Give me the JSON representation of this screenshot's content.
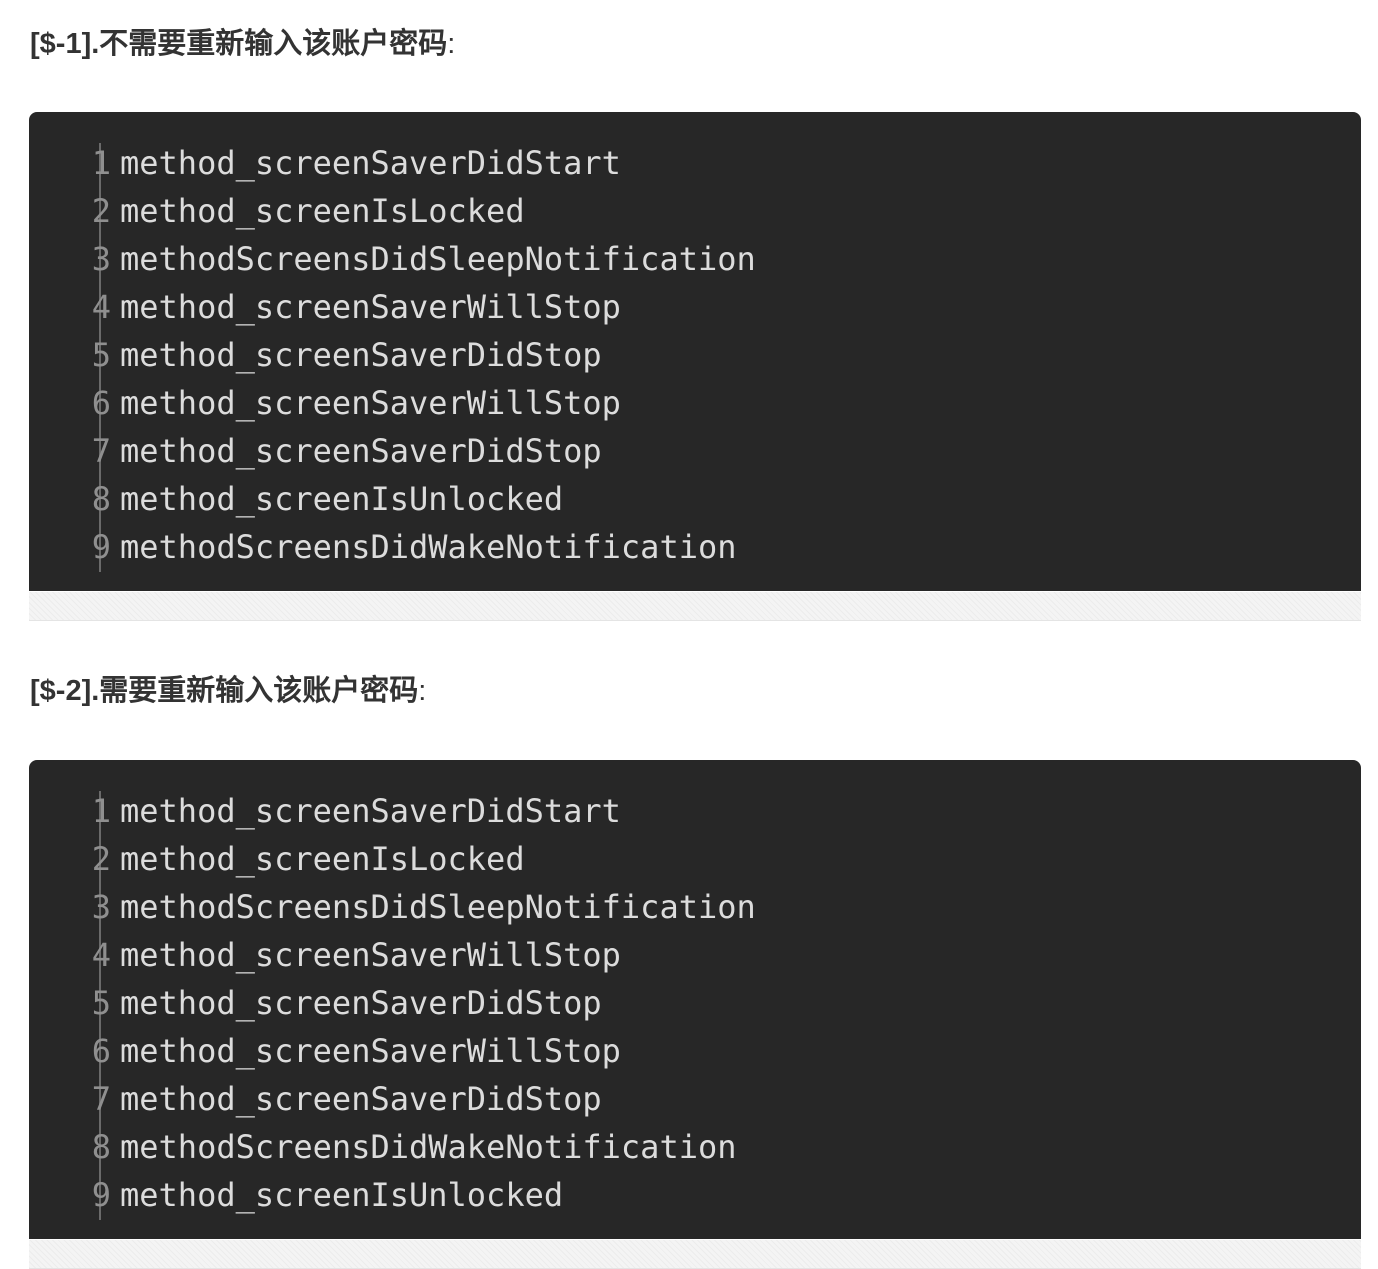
{
  "sections": [
    {
      "heading": "[$-1].不需要重新输入该账户密码",
      "heading_suffix": ":",
      "lines": [
        {
          "num": "1",
          "code": "method_screenSaverDidStart"
        },
        {
          "num": "2",
          "code": "method_screenIsLocked"
        },
        {
          "num": "3",
          "code": "methodScreensDidSleepNotification"
        },
        {
          "num": "4",
          "code": "method_screenSaverWillStop"
        },
        {
          "num": "5",
          "code": "method_screenSaverDidStop"
        },
        {
          "num": "6",
          "code": "method_screenSaverWillStop"
        },
        {
          "num": "7",
          "code": "method_screenSaverDidStop"
        },
        {
          "num": "8",
          "code": "method_screenIsUnlocked"
        },
        {
          "num": "9",
          "code": "methodScreensDidWakeNotification"
        }
      ]
    },
    {
      "heading": "[$-2].需要重新输入该账户密码",
      "heading_suffix": ":",
      "lines": [
        {
          "num": "1",
          "code": "method_screenSaverDidStart"
        },
        {
          "num": "2",
          "code": "method_screenIsLocked"
        },
        {
          "num": "3",
          "code": "methodScreensDidSleepNotification"
        },
        {
          "num": "4",
          "code": "method_screenSaverWillStop"
        },
        {
          "num": "5",
          "code": "method_screenSaverDidStop"
        },
        {
          "num": "6",
          "code": "method_screenSaverWillStop"
        },
        {
          "num": "7",
          "code": "method_screenSaverDidStop"
        },
        {
          "num": "8",
          "code": "methodScreensDidWakeNotification"
        },
        {
          "num": "9",
          "code": "method_screenIsUnlocked"
        }
      ]
    }
  ],
  "colors": {
    "code_background": "#272727",
    "code_text": "#dcdcdc",
    "line_number": "#8f8f8f",
    "heading_text": "#333333"
  }
}
